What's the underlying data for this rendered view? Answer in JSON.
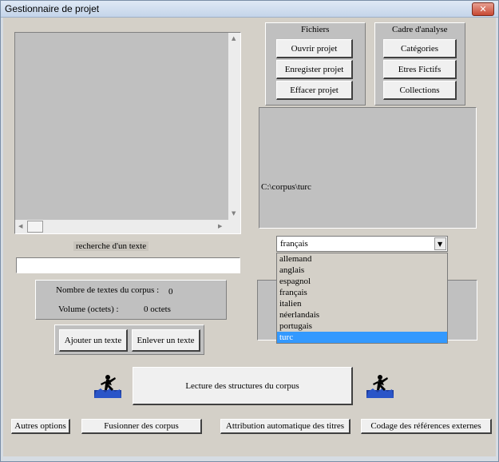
{
  "window": {
    "title": "Gestionnaire de projet",
    "close_label": "✕"
  },
  "fichiers": {
    "title": "Fichiers",
    "open": "Ouvrir projet",
    "save": "Enregister projet",
    "delete": "Effacer projet"
  },
  "cadre": {
    "title": "Cadre d'analyse",
    "categories": "Catégories",
    "etres": "Etres Fictifs",
    "collections": "Collections"
  },
  "path_display": "C:\\corpus\\turc",
  "search": {
    "label": "recherche d'un texte",
    "value": ""
  },
  "stats": {
    "count_label": "Nombre de textes du corpus :",
    "count_value": "0",
    "volume_label": "Volume (octets) :",
    "volume_value": "0 octets"
  },
  "text_buttons": {
    "add": "Ajouter un texte",
    "remove": "Enlever un texte"
  },
  "language": {
    "selected": "français",
    "options": [
      "allemand",
      "anglais",
      "espagnol",
      "français",
      "italien",
      "néerlandais",
      "portugais",
      "turc"
    ],
    "highlighted": "turc"
  },
  "main_action": "Lecture des structures du corpus",
  "bottom_buttons": {
    "other": "Autres options",
    "merge": "Fusionner des corpus",
    "titles": "Attribution automatique des titres",
    "refs": "Codage des références externes"
  },
  "colors": {
    "highlight": "#3399ff",
    "face": "#d4d0c8",
    "panel": "#c0c0c0"
  },
  "icons": {
    "left_figure": "climber-icon",
    "right_figure": "climber-icon"
  }
}
